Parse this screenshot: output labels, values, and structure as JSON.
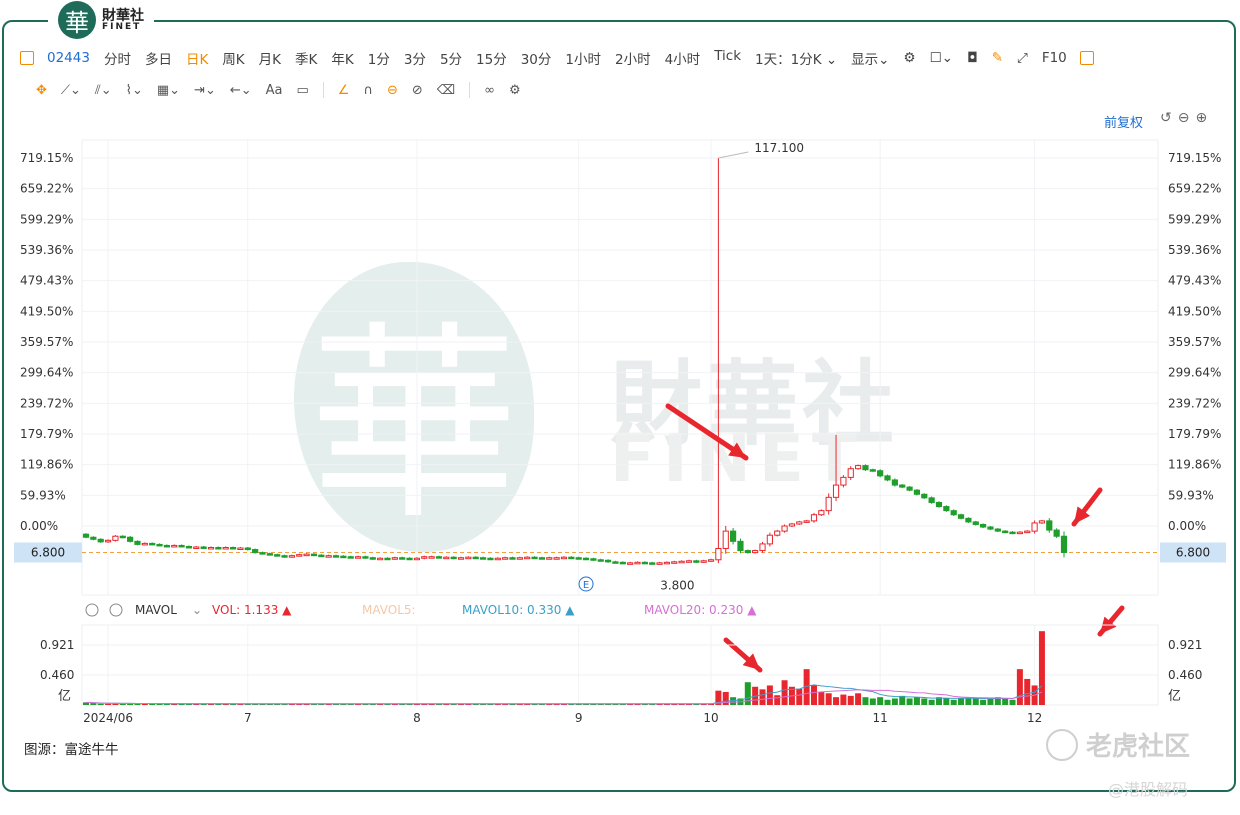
{
  "brand": {
    "seal": "華",
    "name_cn": "財華社",
    "name_en": "FINET"
  },
  "toolbar": {
    "code": "02443",
    "periods": [
      "分时",
      "多日",
      "日K",
      "周K",
      "月K",
      "季K",
      "年K",
      "1分",
      "3分",
      "5分",
      "15分",
      "30分",
      "1小时",
      "2小时",
      "4小时",
      "Tick"
    ],
    "active_period": "日K",
    "interval": "1天：1分K",
    "display": "显示",
    "f10": "F10"
  },
  "toolbar2": {
    "font_label": "Aa"
  },
  "adjust_label": "前复权",
  "watermark": {
    "cn": "財華社",
    "en": "FINET",
    "seal": "華"
  },
  "source": "图源：富途牛牛",
  "tiger": "老虎社区",
  "credit": "@港股解码",
  "colors": {
    "up": "#e8262d",
    "down": "#1f9e2c",
    "accent": "#f08a00",
    "blue": "#1f6fd0",
    "ma10": "#3aa0c8",
    "ma20": "#d66fd6"
  },
  "chart_data": {
    "type": "candlestick",
    "price_axis": {
      "labels": [
        "719.15%",
        "659.22%",
        "599.29%",
        "539.36%",
        "479.43%",
        "419.50%",
        "359.57%",
        "299.64%",
        "239.72%",
        "179.79%",
        "119.86%",
        "59.93%",
        "0.00%"
      ],
      "values": [
        719.15,
        659.22,
        599.29,
        539.36,
        479.43,
        419.5,
        359.57,
        299.64,
        239.72,
        179.79,
        119.86,
        59.93,
        0.0
      ],
      "base_price": 14.1
    },
    "x_labels": [
      {
        "label": "2024/06",
        "i": 3
      },
      {
        "label": "7",
        "i": 22
      },
      {
        "label": "8",
        "i": 45
      },
      {
        "label": "9",
        "i": 67
      },
      {
        "label": "10",
        "i": 85
      },
      {
        "label": "11",
        "i": 108
      },
      {
        "label": "12",
        "i": 129
      }
    ],
    "last_price": "6.800",
    "last_pct": -51.77,
    "max_label": "117.100",
    "min_label": "3.800",
    "event_marker": "E",
    "closes": [
      -22,
      -26,
      -31,
      -28,
      -20,
      -22,
      -30,
      -36,
      -34,
      -36,
      -38,
      -40,
      -38,
      -40,
      -42,
      -41,
      -43,
      -42,
      -44,
      -42,
      -44,
      -43,
      -46,
      -52,
      -54,
      -56,
      -58,
      -60,
      -58,
      -56,
      -55,
      -57,
      -58,
      -58,
      -59,
      -60,
      -61,
      -60,
      -62,
      -64,
      -63,
      -64,
      -62,
      -63,
      -64,
      -63,
      -60,
      -60,
      -61,
      -61,
      -63,
      -62,
      -61,
      -62,
      -63,
      -64,
      -63,
      -62,
      -63,
      -62,
      -61,
      -62,
      -63,
      -62,
      -62,
      -61,
      -62,
      -63,
      -64,
      -66,
      -67,
      -70,
      -71,
      -72,
      -72,
      -71,
      -72,
      -73,
      -72,
      -71,
      -70,
      -69,
      -68,
      -70,
      -68,
      -66,
      -44,
      -10,
      -30,
      -48,
      -52,
      -48,
      -35,
      -18,
      -10,
      0,
      4,
      8,
      10,
      22,
      30,
      56,
      80,
      95,
      112,
      118,
      110,
      108,
      98,
      90,
      80,
      76,
      70,
      62,
      55,
      46,
      38,
      30,
      22,
      15,
      8,
      3,
      -2,
      -6,
      -10,
      -12,
      -14,
      -12,
      -10,
      6,
      10,
      -8,
      -20,
      -51.77
    ],
    "highs": {
      "86": 719.15,
      "102": 178
    },
    "volume": {
      "axis_labels": [
        "0.921",
        "0.460",
        "亿"
      ],
      "indicator": "MAVOL",
      "vol": "VOL: 1.133",
      "mavol5": "MAVOL5:",
      "mavol10": "MAVOL10: 0.330",
      "mavol20": "MAVOL20: 0.230",
      "values": [
        0.04,
        0.03,
        0.02,
        0.02,
        0.02,
        0.02,
        0.02,
        0.02,
        0.02,
        0.02,
        0.02,
        0.02,
        0.02,
        0.02,
        0.02,
        0.02,
        0.02,
        0.02,
        0.02,
        0.02,
        0.02,
        0.02,
        0.02,
        0.02,
        0.02,
        0.02,
        0.02,
        0.02,
        0.02,
        0.02,
        0.02,
        0.02,
        0.02,
        0.02,
        0.02,
        0.02,
        0.02,
        0.02,
        0.02,
        0.02,
        0.02,
        0.02,
        0.02,
        0.02,
        0.02,
        0.02,
        0.02,
        0.02,
        0.02,
        0.02,
        0.02,
        0.02,
        0.02,
        0.02,
        0.02,
        0.02,
        0.02,
        0.02,
        0.02,
        0.02,
        0.02,
        0.02,
        0.02,
        0.02,
        0.02,
        0.02,
        0.02,
        0.02,
        0.02,
        0.02,
        0.02,
        0.02,
        0.02,
        0.02,
        0.02,
        0.02,
        0.02,
        0.02,
        0.02,
        0.02,
        0.02,
        0.02,
        0.02,
        0.02,
        0.02,
        0.02,
        0.22,
        0.2,
        0.12,
        0.1,
        0.35,
        0.28,
        0.24,
        0.3,
        0.15,
        0.38,
        0.28,
        0.25,
        0.55,
        0.3,
        0.2,
        0.18,
        0.12,
        0.16,
        0.14,
        0.18,
        0.12,
        0.1,
        0.12,
        0.08,
        0.1,
        0.14,
        0.1,
        0.12,
        0.1,
        0.08,
        0.12,
        0.1,
        0.08,
        0.1,
        0.12,
        0.1,
        0.08,
        0.1,
        0.12,
        0.1,
        0.08,
        0.55,
        0.4,
        0.3,
        1.133
      ]
    }
  }
}
